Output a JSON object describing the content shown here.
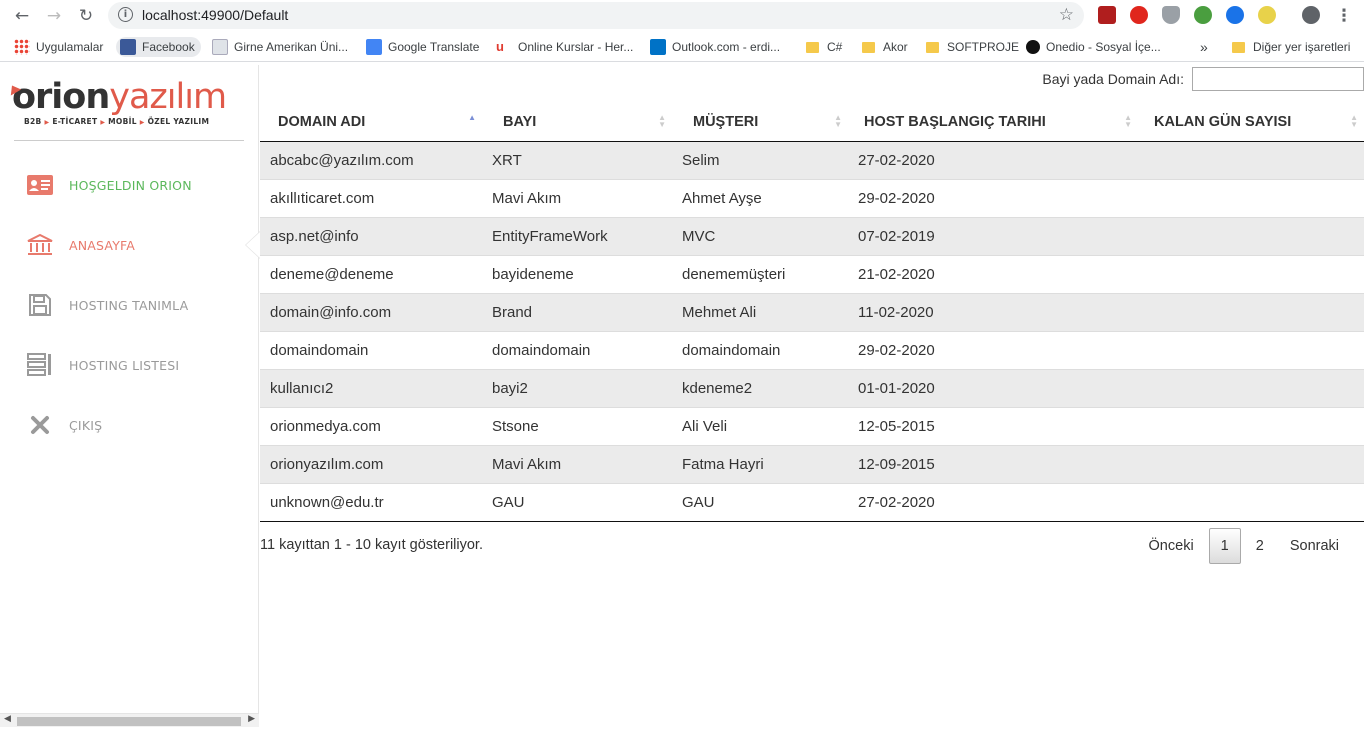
{
  "browser": {
    "url": "localhost:49900/Default",
    "bookmarks": [
      {
        "label": "Uygulamalar",
        "icon": "apps-grid-icon"
      },
      {
        "label": "Facebook",
        "icon": "facebook-icon"
      },
      {
        "label": "Girne Amerikan Üni...",
        "icon": "page-icon"
      },
      {
        "label": "Google Translate",
        "icon": "translate-icon"
      },
      {
        "label": "Online Kurslar - Her...",
        "icon": "udemy-icon"
      },
      {
        "label": "Outlook.com - erdi...",
        "icon": "outlook-icon"
      },
      {
        "label": "C#",
        "icon": "folder-icon"
      },
      {
        "label": "Akor",
        "icon": "folder-icon"
      },
      {
        "label": "SOFTPROJE",
        "icon": "folder-icon"
      },
      {
        "label": "Onedio - Sosyal İçe...",
        "icon": "onedio-icon"
      },
      {
        "label": "»",
        "icon": ""
      },
      {
        "label": "Diğer yer işaretleri",
        "icon": "folder-icon"
      }
    ]
  },
  "logo": {
    "part1": "orion",
    "part2": "yazılım",
    "tagline": [
      "B2B",
      "E-TİCARET",
      "MOBİL",
      "ÖZEL YAZILIM"
    ]
  },
  "menu": [
    {
      "label": "HOŞGELDIN ORION",
      "color": "#5cb85c"
    },
    {
      "label": "ANASAYFA",
      "color": "#e87a6c"
    },
    {
      "label": "HOSTING TANIMLA",
      "color": "#9a9a9a"
    },
    {
      "label": "HOSTING LISTESI",
      "color": "#9a9a9a"
    },
    {
      "label": "ÇIKIŞ",
      "color": "#9a9a9a"
    }
  ],
  "search": {
    "label": "Bayi yada Domain Adı:",
    "value": ""
  },
  "table": {
    "headers": [
      "DOMAIN ADI",
      "BAYI",
      "MÜŞTERI",
      "HOST BAŞLANGIÇ TARIHI",
      "KALAN GÜN SAYISI"
    ],
    "rows": [
      [
        "abcabc@yazılım.com",
        "XRT",
        "Selim",
        "27-02-2020",
        ""
      ],
      [
        "akıllıticaret.com",
        "Mavi Akım",
        "Ahmet Ayşe",
        "29-02-2020",
        ""
      ],
      [
        "asp.net@info",
        "EntityFrameWork",
        "MVC",
        "07-02-2019",
        ""
      ],
      [
        "deneme@deneme",
        "bayideneme",
        "denememüşteri",
        "21-02-2020",
        ""
      ],
      [
        "domain@info.com",
        "Brand",
        "Mehmet Ali",
        "11-02-2020",
        ""
      ],
      [
        "domaindomain",
        "domaindomain",
        "domaindomain",
        "29-02-2020",
        ""
      ],
      [
        "kullanıcı2",
        "bayi2",
        "kdeneme2",
        "01-01-2020",
        ""
      ],
      [
        "orionmedya.com",
        "Stsone",
        "Ali Veli",
        "12-05-2015",
        ""
      ],
      [
        "orionyazılım.com",
        "Mavi Akım",
        "Fatma Hayri",
        "12-09-2015",
        ""
      ],
      [
        "unknown@edu.tr",
        "GAU",
        "GAU",
        "27-02-2020",
        ""
      ]
    ]
  },
  "footer": {
    "info": "11 kayıttan 1 - 10 kayıt gösteriliyor.",
    "prev": "Önceki",
    "pages": [
      "1",
      "2"
    ],
    "next": "Sonraki"
  }
}
